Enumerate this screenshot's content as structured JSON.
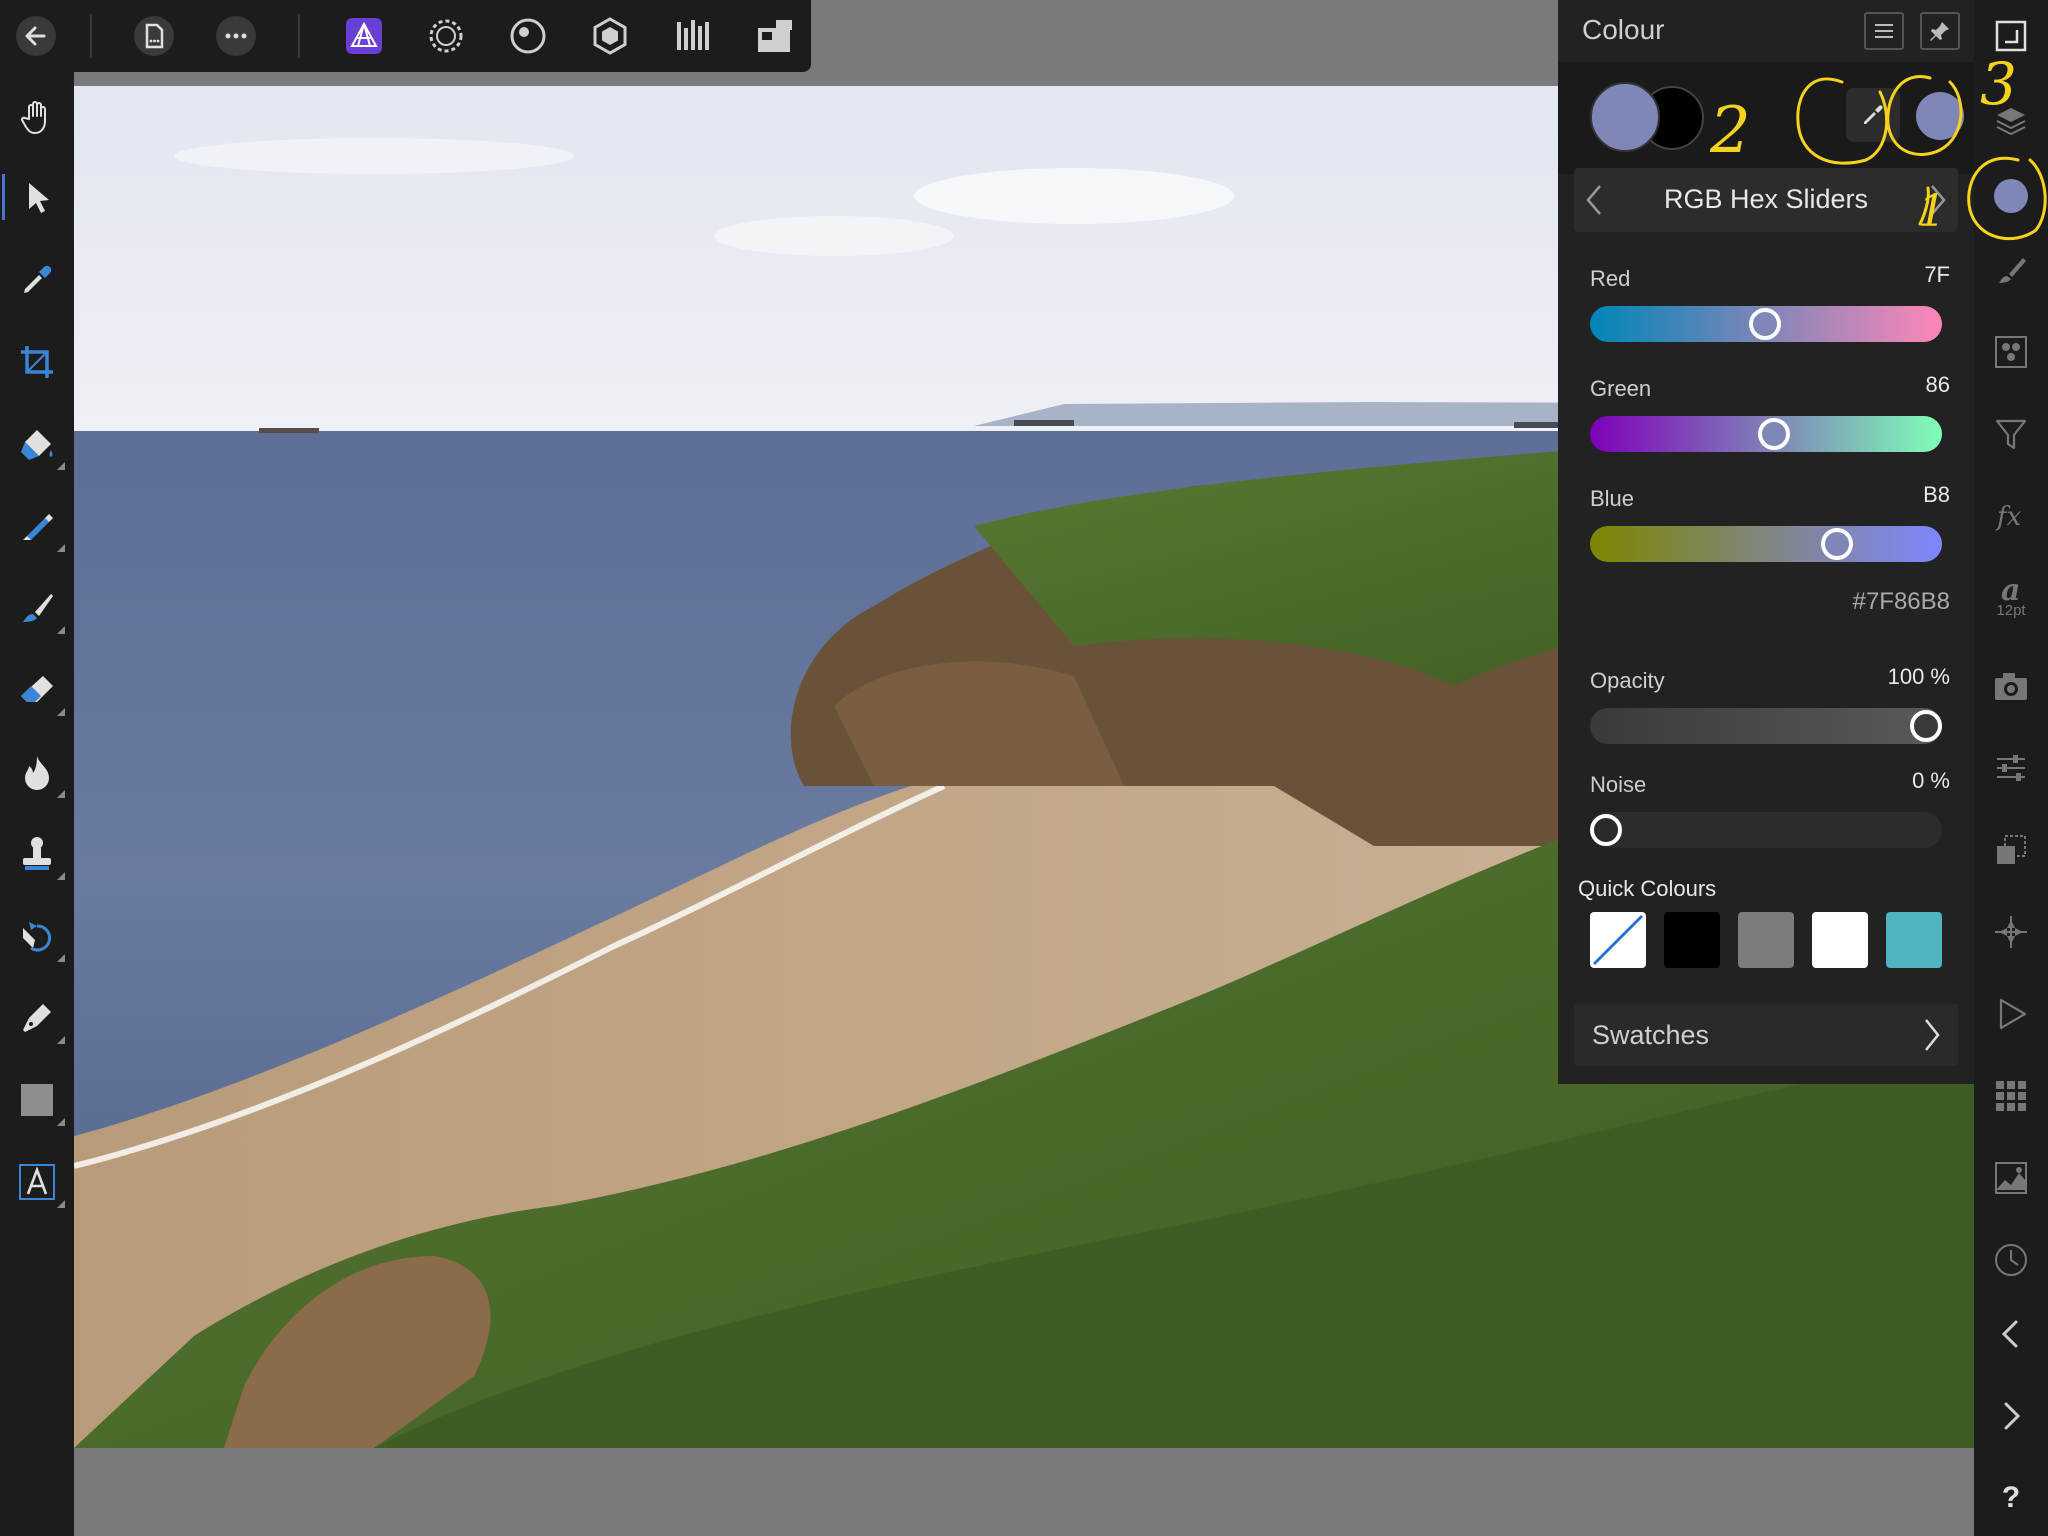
{
  "colors": {
    "toolbar_bg": "#1c1c1c",
    "panel_bg": "#222222",
    "canvas_bg": "#7a7a7a",
    "active_accent": "#4a74c9",
    "primary_colour": "#7F86B8",
    "secondary_colour": "#000000",
    "annotation": "#f6d21c"
  },
  "topbar": {
    "icons": [
      "back-arrow-icon",
      "document-icon",
      "more-icon",
      "photo-persona-icon",
      "liquify-persona-icon",
      "develop-persona-icon",
      "tone-mapping-persona-icon",
      "export-persona-icon",
      "view-mode-icon"
    ]
  },
  "left_tools": [
    "view-tool-hand-icon",
    "move-tool-icon",
    "colour-picker-tool-icon",
    "crop-tool-icon",
    "flood-fill-tool-icon",
    "selection-brush-tool-icon",
    "paint-brush-tool-icon",
    "erase-brush-tool-icon",
    "dodge-burn-tool-icon",
    "clone-stamp-tool-icon",
    "red-eye-tool-icon",
    "pen-tool-icon",
    "rectangle-shape-tool-icon",
    "text-tool-icon"
  ],
  "studio": {
    "text_style_size": "12pt",
    "icons": [
      "fullscreen-icon",
      "layers-icon",
      "colour-studio-icon",
      "brushes-icon",
      "channels-icon",
      "filter-icon",
      "fx-icon",
      "text-style-icon",
      "camera-icon",
      "adjustments-icon",
      "transform-icon",
      "navigator-icon",
      "macro-play-icon",
      "grid-icon",
      "histogram-icon",
      "history-icon",
      "undo-icon",
      "redo-icon",
      "help-icon"
    ],
    "help_glyph": "?"
  },
  "colour_panel": {
    "title": "Colour",
    "mode_label": "RGB Hex Sliders",
    "sliders": [
      {
        "label": "Red",
        "value": "7F",
        "position": 0.498
      },
      {
        "label": "Green",
        "value": "86",
        "position": 0.525
      },
      {
        "label": "Blue",
        "value": "B8",
        "position": 0.722
      }
    ],
    "hex": "#7F86B8",
    "opacity": {
      "label": "Opacity",
      "value": "100 %",
      "position": 1.0
    },
    "noise": {
      "label": "Noise",
      "value": "0 %",
      "position": 0.0
    },
    "quick_colours_label": "Quick Colours",
    "quick_colours": [
      "none",
      "#000000",
      "#7c7c7c",
      "#ffffff",
      "#4fb3c2"
    ],
    "swatches_label": "Swatches"
  },
  "annotations": {
    "labels": [
      "1",
      "2",
      "3"
    ]
  }
}
